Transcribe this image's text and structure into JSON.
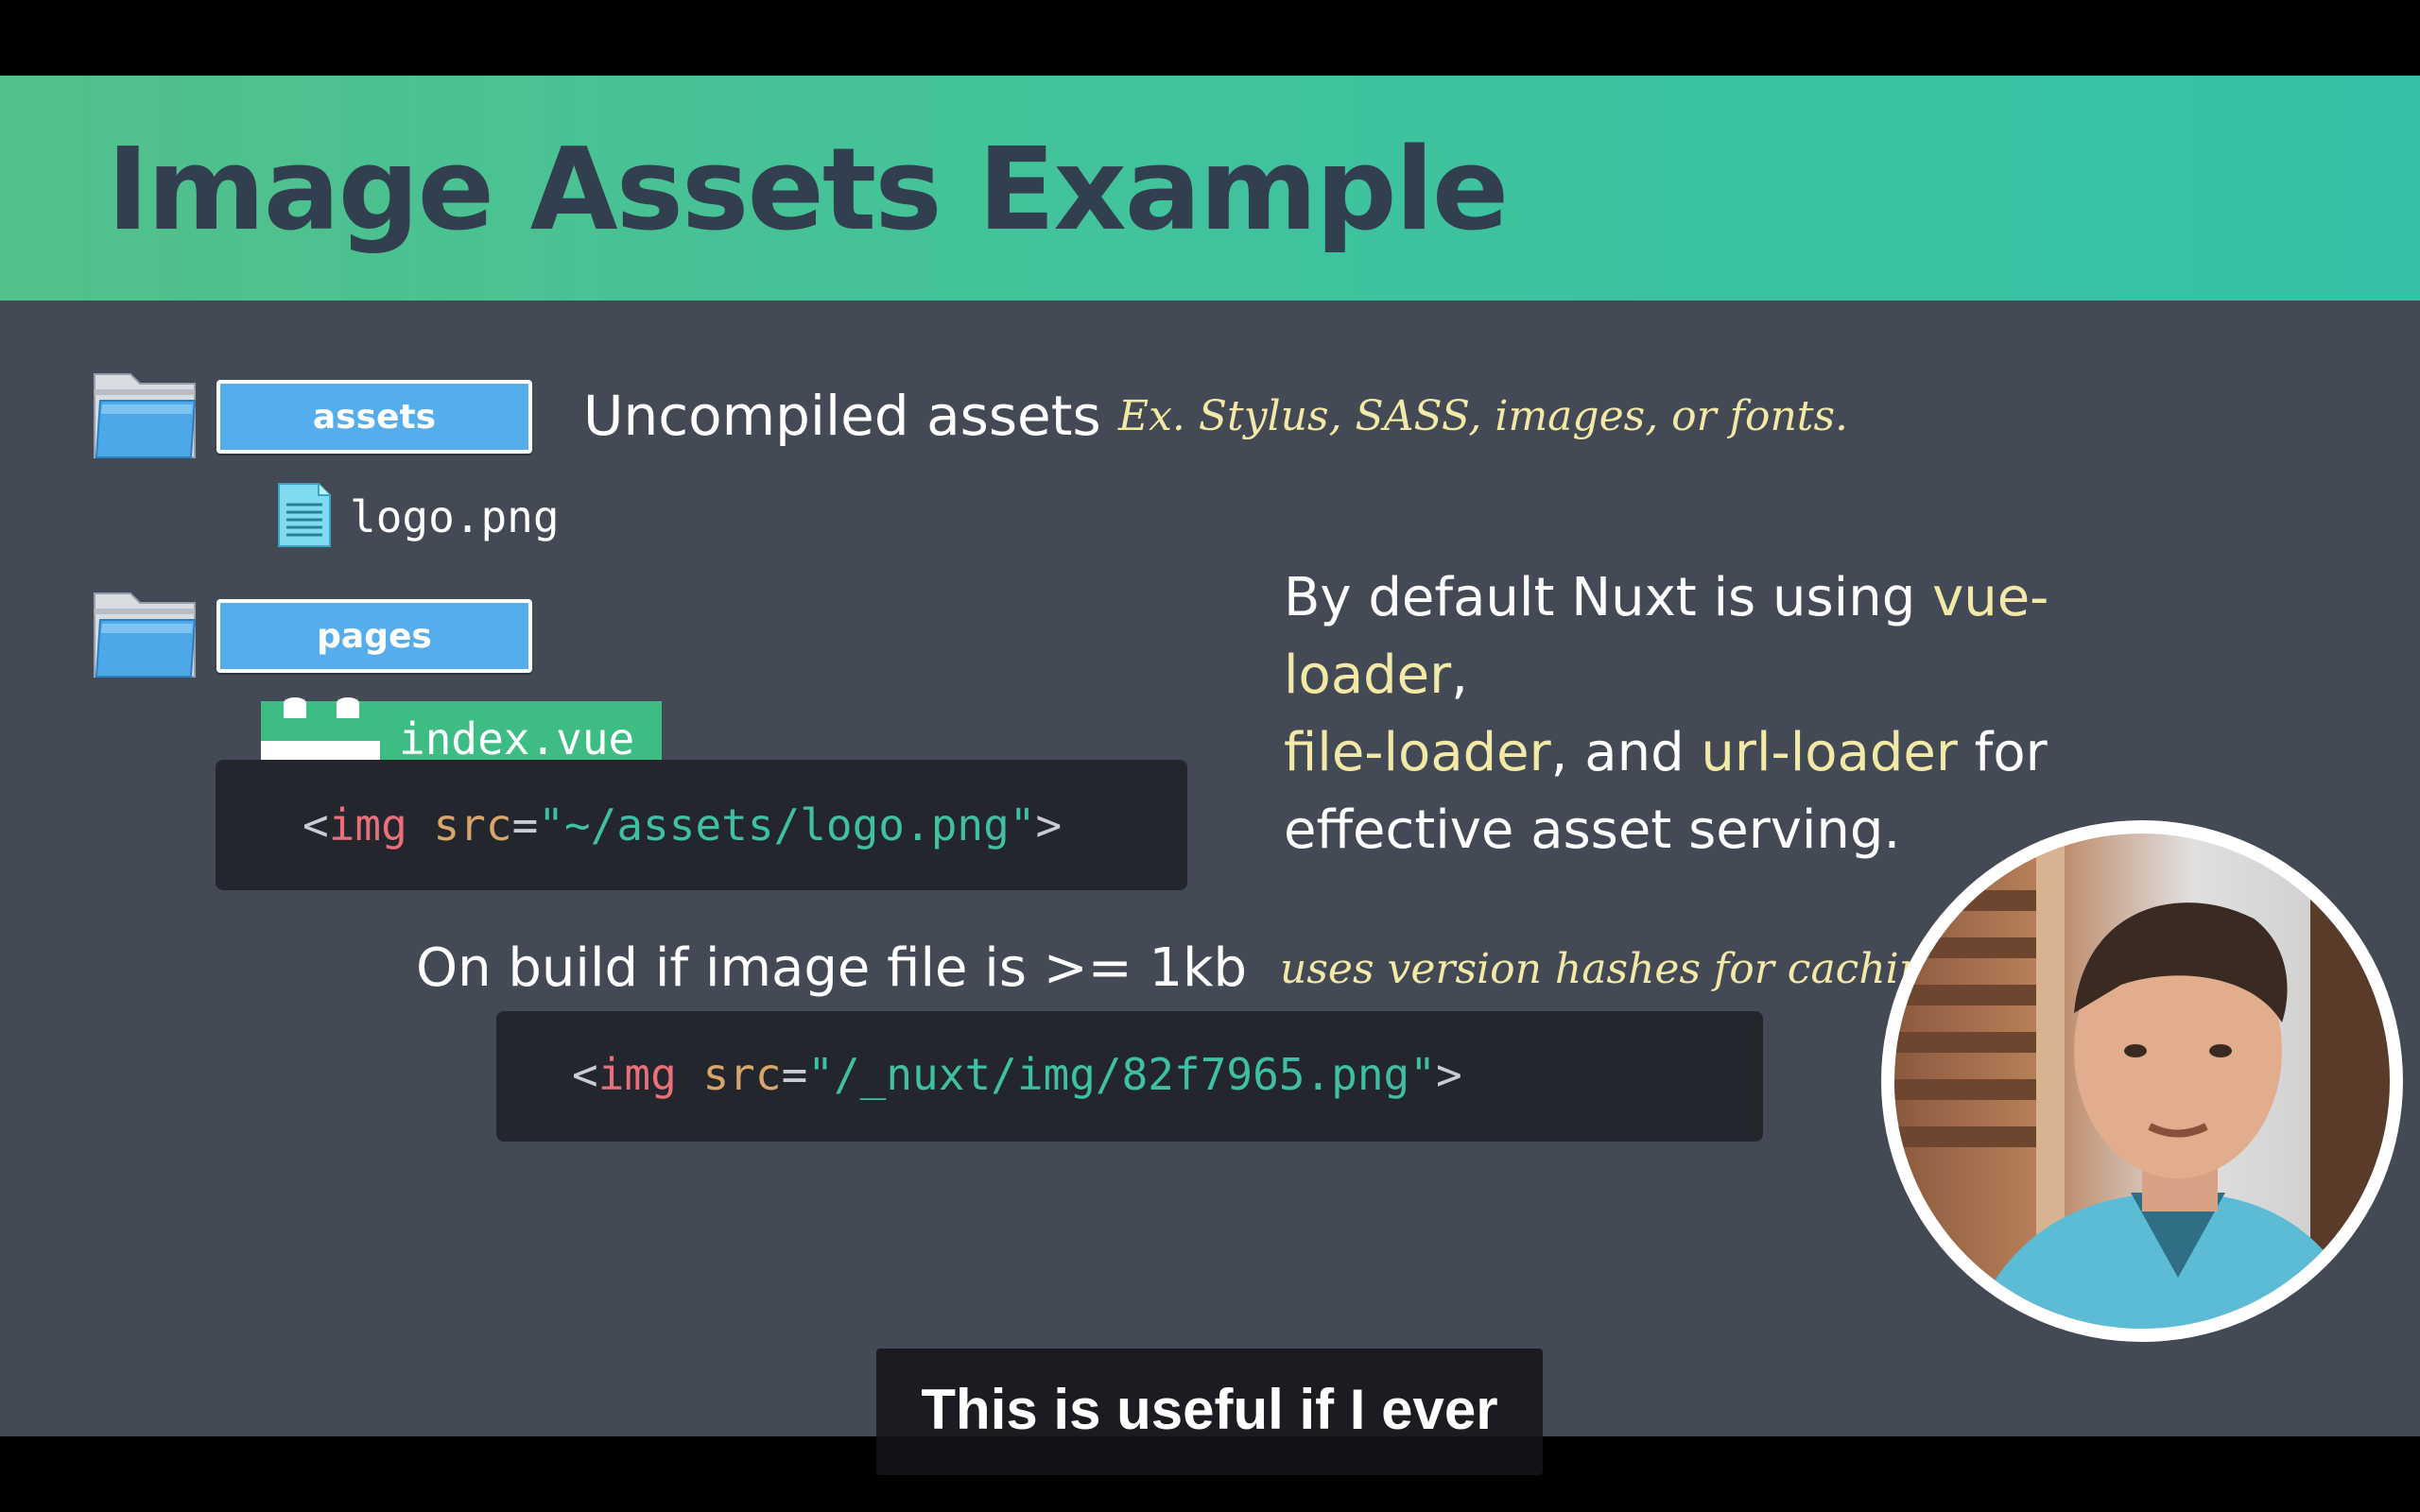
{
  "slide": {
    "title": "Image Assets Example",
    "folders": [
      {
        "label": "assets",
        "description": "Uncompiled assets",
        "note": "Ex. Stylus, SASS, images, or fonts."
      },
      {
        "label": "pages"
      }
    ],
    "asset_file": "logo.png",
    "page_file": "index.vue",
    "code1": {
      "open": "<",
      "tag": "img",
      "attr": " src",
      "eq": "=",
      "value": "\"~/assets/logo.png\"",
      "close": ">"
    },
    "explanation": {
      "prefix": "By default Nuxt is using ",
      "loader1": "vue-loader",
      "sep1": ",",
      "loader2": "file-loader",
      "sep2": ", and ",
      "loader3": "url-loader",
      "suffix_line2": " for",
      "line3": "effective asset serving."
    },
    "build_text": "On build if image file is >= 1kb",
    "build_note": "uses version hashes for caching",
    "code2": {
      "open": "<",
      "tag": "img",
      "attr": " src",
      "eq": "=",
      "value": "\"/_nuxt/img/82f7965.png\"",
      "close": ">"
    }
  },
  "caption": "This is useful if I ever",
  "colors": {
    "header_gradient_start": "#52c08a",
    "header_gradient_end": "#33c2a6",
    "slide_bg": "#444a55",
    "highlight": "#f3e9a6",
    "folder_label": "#55adec",
    "vue_green": "#3dbd83"
  },
  "icons": [
    "folder-icon",
    "document-icon",
    "vue-component-icon",
    "presenter-avatar"
  ]
}
